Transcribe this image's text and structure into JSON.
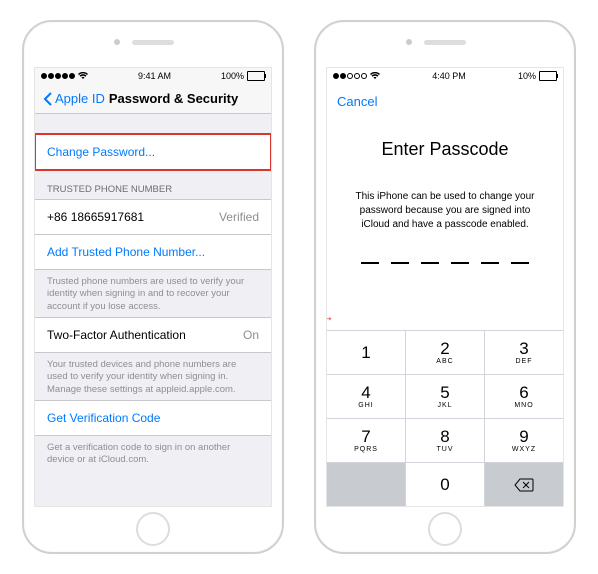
{
  "left": {
    "status": {
      "time": "9:41 AM",
      "battery": "100%"
    },
    "nav": {
      "back": "Apple ID",
      "title": "Password & Security"
    },
    "change_password": "Change Password...",
    "trusted_header": "TRUSTED PHONE NUMBER",
    "phone": "+86 18665917681",
    "verified": "Verified",
    "add_number": "Add Trusted Phone Number...",
    "trusted_footer": "Trusted phone numbers are used to verify your identity when signing in and to recover your account if you lose access.",
    "twofa_label": "Two-Factor Authentication",
    "twofa_value": "On",
    "twofa_footer": "Your trusted devices and phone numbers are used to verify your identity when signing in. Manage these settings at appleid.apple.com.",
    "get_code": "Get Verification Code",
    "get_code_footer": "Get a verification code to sign in on another device or at iCloud.com."
  },
  "right": {
    "status": {
      "time": "4:40 PM",
      "battery": "10%"
    },
    "cancel": "Cancel",
    "title": "Enter Passcode",
    "message": "This iPhone can be used to change your password because you are signed into iCloud and have a passcode enabled.",
    "keys": [
      {
        "num": "1",
        "let": ""
      },
      {
        "num": "2",
        "let": "ABC"
      },
      {
        "num": "3",
        "let": "DEF"
      },
      {
        "num": "4",
        "let": "GHI"
      },
      {
        "num": "5",
        "let": "JKL"
      },
      {
        "num": "6",
        "let": "MNO"
      },
      {
        "num": "7",
        "let": "PQRS"
      },
      {
        "num": "8",
        "let": "TUV"
      },
      {
        "num": "9",
        "let": "WXYZ"
      }
    ]
  }
}
